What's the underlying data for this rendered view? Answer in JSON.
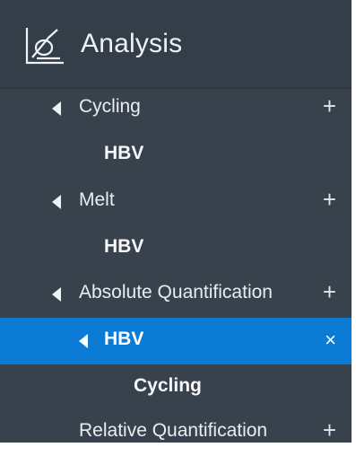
{
  "header": {
    "title": "Analysis",
    "icon": "analysis-chart-icon"
  },
  "tree": {
    "cycling": {
      "label": "Cycling",
      "action": "+",
      "child": "HBV"
    },
    "melt": {
      "label": "Melt",
      "action": "+",
      "child": "HBV"
    },
    "absolute": {
      "label": "Absolute Quantification",
      "action": "+",
      "hbv": {
        "label": "HBV",
        "action": "×",
        "child": "Cycling"
      }
    },
    "relative": {
      "label": "Relative Quantification",
      "action": "+"
    }
  },
  "colors": {
    "panel": "#38424c",
    "selected": "#0c7bd6",
    "text": "#e8edf1"
  }
}
